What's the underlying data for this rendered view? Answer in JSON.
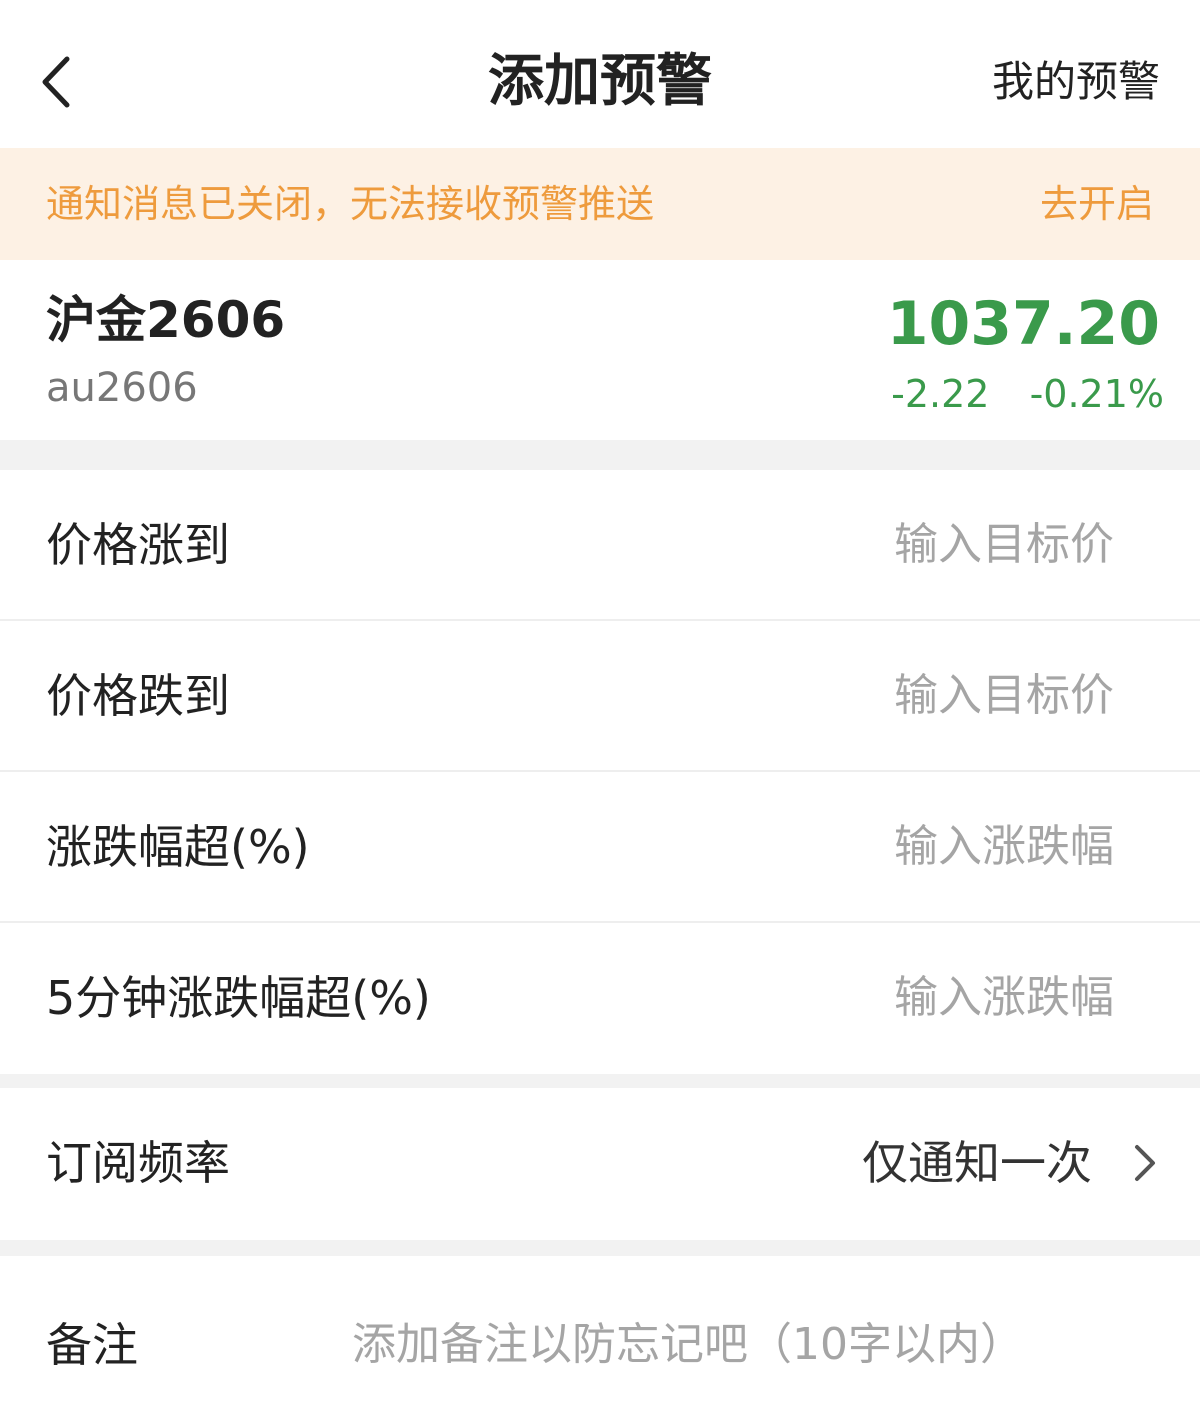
{
  "header": {
    "title": "添加预警",
    "my_alerts": "我的预警",
    "back_icon": "chevron-left-icon"
  },
  "notice": {
    "text": "通知消息已关闭，无法接收预警推送",
    "action": "去开启",
    "color": "#ee9b3d",
    "background": "#fdf1e4"
  },
  "quote": {
    "name": "沪金2606",
    "code": "au2606",
    "price": "1037.20",
    "change": "-2.22",
    "change_pct": "-0.21%",
    "color": "#3a9a4b"
  },
  "conditions": [
    {
      "label": "价格涨到",
      "placeholder": "输入目标价"
    },
    {
      "label": "价格跌到",
      "placeholder": "输入目标价"
    },
    {
      "label": "涨跌幅超(%)",
      "placeholder": "输入涨跌幅"
    },
    {
      "label": "5分钟涨跌幅超(%)",
      "placeholder": "输入涨跌幅"
    }
  ],
  "frequency": {
    "label": "订阅频率",
    "value": "仅通知一次",
    "icon": "chevron-right-icon"
  },
  "note": {
    "label": "备注",
    "placeholder": "添加备注以防忘记吧（10字以内）"
  }
}
